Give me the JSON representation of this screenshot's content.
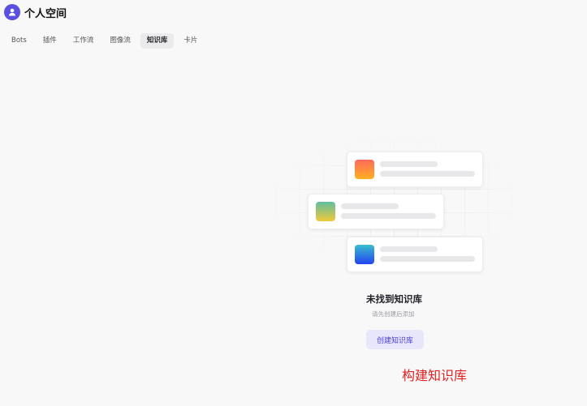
{
  "header": {
    "title": "个人空间",
    "avatar_icon": "user-icon"
  },
  "tabs": [
    {
      "label": "Bots",
      "active": false
    },
    {
      "label": "插件",
      "active": false
    },
    {
      "label": "工作流",
      "active": false
    },
    {
      "label": "图像流",
      "active": false
    },
    {
      "label": "知识库",
      "active": true
    },
    {
      "label": "卡片",
      "active": false
    }
  ],
  "empty_state": {
    "title": "未找到知识库",
    "subtitle": "请先创建后添加",
    "button_label": "创建知识库"
  },
  "annotation": {
    "text": "构建知识库",
    "color": "#e02020"
  },
  "colors": {
    "accent": "#5a4fe0",
    "button_bg": "#e7e6fb",
    "button_text": "#4a40d8"
  }
}
